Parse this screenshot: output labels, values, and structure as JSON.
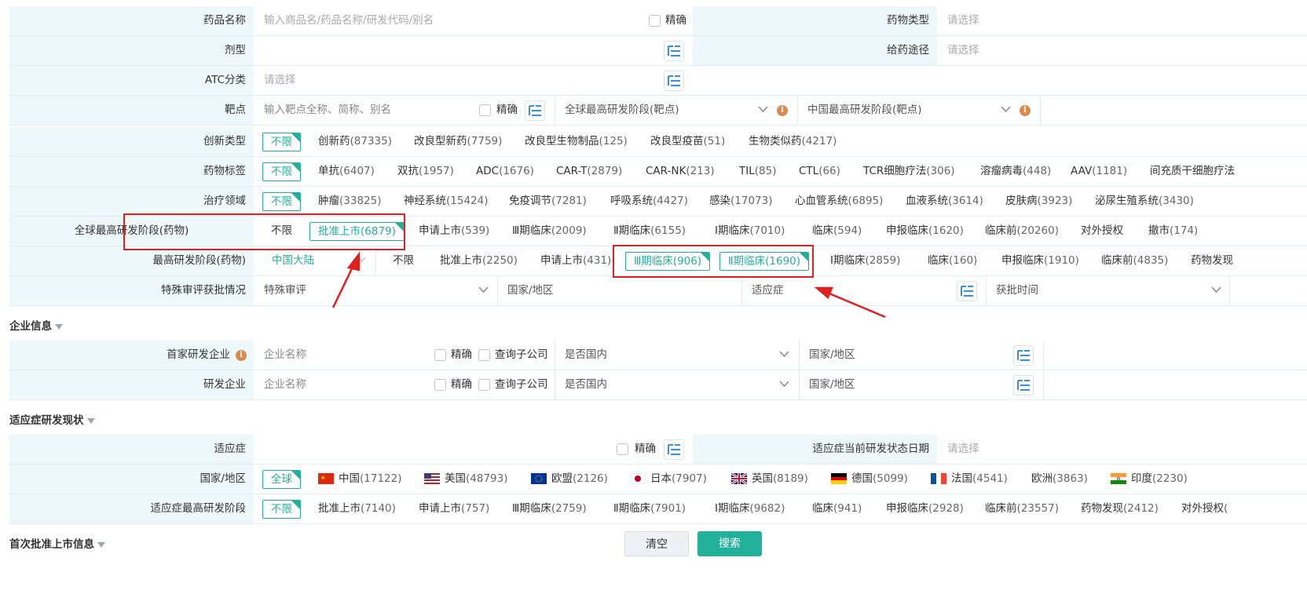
{
  "drug_search": {
    "drug_name": {
      "label": "药品名称",
      "placeholder": "输入商品名/药品名称/研发代码/别名",
      "exact": "精确"
    },
    "drug_type": {
      "label": "药物类型",
      "placeholder": "请选择"
    },
    "dosage_form": {
      "label": "剂型"
    },
    "route": {
      "label": "给药途径",
      "placeholder": "请选择"
    },
    "atc": {
      "label": "ATC分类",
      "placeholder": "请选择"
    },
    "target": {
      "label": "靶点",
      "placeholder": "输入靶点全称、简称、别名",
      "exact": "精确",
      "global_stage": "全球最高研发阶段(靶点)",
      "china_stage": "中国最高研发阶段(靶点)"
    },
    "innovation": {
      "label": "创新类型",
      "all": "不限",
      "options": [
        {
          "name": "创新药",
          "count": "(87335)"
        },
        {
          "name": "改良型新药",
          "count": "(7759)"
        },
        {
          "name": "改良型生物制品",
          "count": "(125)"
        },
        {
          "name": "改良型疫苗",
          "count": "(51)"
        },
        {
          "name": "生物类似药",
          "count": "(4217)"
        }
      ]
    },
    "drug_tags": {
      "label": "药物标签",
      "all": "不限",
      "options": [
        {
          "name": "单抗",
          "count": "(6407)"
        },
        {
          "name": "双抗",
          "count": "(1957)"
        },
        {
          "name": "ADC",
          "count": "(1676)"
        },
        {
          "name": "CAR-T",
          "count": "(2879)"
        },
        {
          "name": "CAR-NK",
          "count": "(213)"
        },
        {
          "name": "TIL",
          "count": "(85)"
        },
        {
          "name": "CTL",
          "count": "(66)"
        },
        {
          "name": "TCR细胞疗法",
          "count": "(306)"
        },
        {
          "name": "溶瘤病毒",
          "count": "(448)"
        },
        {
          "name": "AAV",
          "count": "(1181)"
        },
        {
          "name": "间充质干细胞疗法",
          "count": ""
        }
      ]
    },
    "therapy_area": {
      "label": "治疗领域",
      "all": "不限",
      "options": [
        {
          "name": "肿瘤",
          "count": "(33825)"
        },
        {
          "name": "神经系统",
          "count": "(15424)"
        },
        {
          "name": "免疫调节",
          "count": "(7281)"
        },
        {
          "name": "呼吸系统",
          "count": "(4427)"
        },
        {
          "name": "感染",
          "count": "(17073)"
        },
        {
          "name": "心血管系统",
          "count": "(6895)"
        },
        {
          "name": "血液系统",
          "count": "(3614)"
        },
        {
          "name": "皮肤病",
          "count": "(3923)"
        },
        {
          "name": "泌尿生殖系统",
          "count": "(3430)"
        }
      ]
    },
    "global_stage": {
      "label": "全球最高研发阶段(药物)",
      "all": "不限",
      "selected": "批准上市(6879)",
      "options": [
        {
          "name": "申请上市",
          "count": "(539)"
        },
        {
          "name": "Ⅲ期临床",
          "count": "(2009)"
        },
        {
          "name": "Ⅱ期临床",
          "count": "(6155)"
        },
        {
          "name": "Ⅰ期临床",
          "count": "(7010)"
        },
        {
          "name": "临床",
          "count": "(594)"
        },
        {
          "name": "申报临床",
          "count": "(1620)"
        },
        {
          "name": "临床前",
          "count": "(20260)"
        },
        {
          "name": "对外授权",
          "count": ""
        },
        {
          "name": "撤市",
          "count": "(174)"
        }
      ]
    },
    "top_stage": {
      "label": "最高研发阶段(药物)",
      "region": "中国大陆",
      "all": "不限",
      "opt1": {
        "name": "批准上市",
        "count": "(2250)"
      },
      "opt2": {
        "name": "申请上市",
        "count": "(431)"
      },
      "selected1": "Ⅲ期临床(906)",
      "selected2": "Ⅱ期临床(1690)",
      "options": [
        {
          "name": "Ⅰ期临床",
          "count": "(2859)"
        },
        {
          "name": "临床",
          "count": "(160)"
        },
        {
          "name": "申报临床",
          "count": "(1910)"
        },
        {
          "name": "临床前",
          "count": "(4835)"
        },
        {
          "name": "药物发现",
          "count": ""
        }
      ]
    },
    "special_review": {
      "label": "特殊审评获批情况",
      "review": "特殊审评",
      "country": "国家/地区",
      "indication": "适应症",
      "approval_time": "获批时间"
    }
  },
  "company_section": {
    "title": "企业信息",
    "first_company": {
      "label": "首家研发企业",
      "placeholder": "企业名称",
      "exact": "精确",
      "subsidiary": "查询子公司",
      "domestic": "是否国内",
      "country": "国家/地区"
    },
    "company": {
      "label": "研发企业",
      "placeholder": "企业名称",
      "exact": "精确",
      "subsidiary": "查询子公司",
      "domestic": "是否国内",
      "country": "国家/地区"
    }
  },
  "indication_section": {
    "title": "适应症研发现状",
    "indication": {
      "label": "适应症",
      "exact": "精确",
      "date_label": "适应症当前研发状态日期",
      "date_placeholder": "请选择"
    },
    "country": {
      "label": "国家/地区",
      "all": "全球",
      "options": [
        {
          "name": "中国",
          "count": "(17122)",
          "flag": "cn"
        },
        {
          "name": "美国",
          "count": "(48793)",
          "flag": "us"
        },
        {
          "name": "欧盟",
          "count": "(2126)",
          "flag": "eu"
        },
        {
          "name": "日本",
          "count": "(7907)",
          "flag": "jp"
        },
        {
          "name": "英国",
          "count": "(8189)",
          "flag": "uk"
        },
        {
          "name": "德国",
          "count": "(5099)",
          "flag": "de"
        },
        {
          "name": "法国",
          "count": "(4541)",
          "flag": "fr"
        },
        {
          "name": "欧洲",
          "count": "(3863)",
          "flag": ""
        },
        {
          "name": "印度",
          "count": "(2230)",
          "flag": "in"
        }
      ]
    },
    "stage": {
      "label": "适应症最高研发阶段",
      "all": "不限",
      "options": [
        {
          "name": "批准上市",
          "count": "(7140)"
        },
        {
          "name": "申请上市",
          "count": "(757)"
        },
        {
          "name": "Ⅲ期临床",
          "count": "(2759)"
        },
        {
          "name": "Ⅱ期临床",
          "count": "(7901)"
        },
        {
          "name": "Ⅰ期临床",
          "count": "(9682)"
        },
        {
          "name": "临床",
          "count": "(941)"
        },
        {
          "name": "申报临床",
          "count": "(2928)"
        },
        {
          "name": "临床前",
          "count": "(23557)"
        },
        {
          "name": "药物发现",
          "count": "(2412)"
        },
        {
          "name": "对外授权",
          "count": "("
        }
      ]
    }
  },
  "first_approval_section": {
    "title": "首次批准上市信息"
  },
  "actions": {
    "clear": "清空",
    "search": "搜索"
  },
  "colors": {
    "accent": "#22b09b",
    "label_bg": "#eef7f9",
    "highlight": "#e02020"
  }
}
